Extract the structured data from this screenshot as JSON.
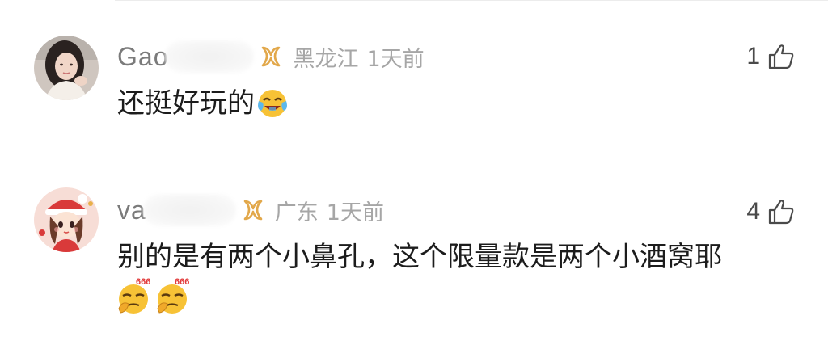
{
  "comments": [
    {
      "username_visible": "Gao",
      "location": "黑龙江",
      "time": "1天前",
      "likes": "1",
      "text": "还挺好玩的",
      "emoji": "laughing-crying-emoji"
    },
    {
      "username_visible": "va",
      "location": "广东",
      "time": "1天前",
      "likes": "4",
      "text": "别的是有两个小鼻孔，这个限量款是两个小酒窝耶",
      "emojis": [
        "thinking-666-emoji",
        "thinking-666-emoji"
      ],
      "emoji_caption": "666"
    }
  ],
  "icons": {
    "vip": "vip-icon",
    "like": "thumb-up-icon"
  },
  "colors": {
    "vip_gold": "#e2a84b",
    "meta_gray": "#a6a6a6",
    "name_gray": "#7b7b7b",
    "text": "#1c1c1c",
    "emoji_red": "#e23b3b",
    "emoji_yellow": "#f7c236"
  }
}
